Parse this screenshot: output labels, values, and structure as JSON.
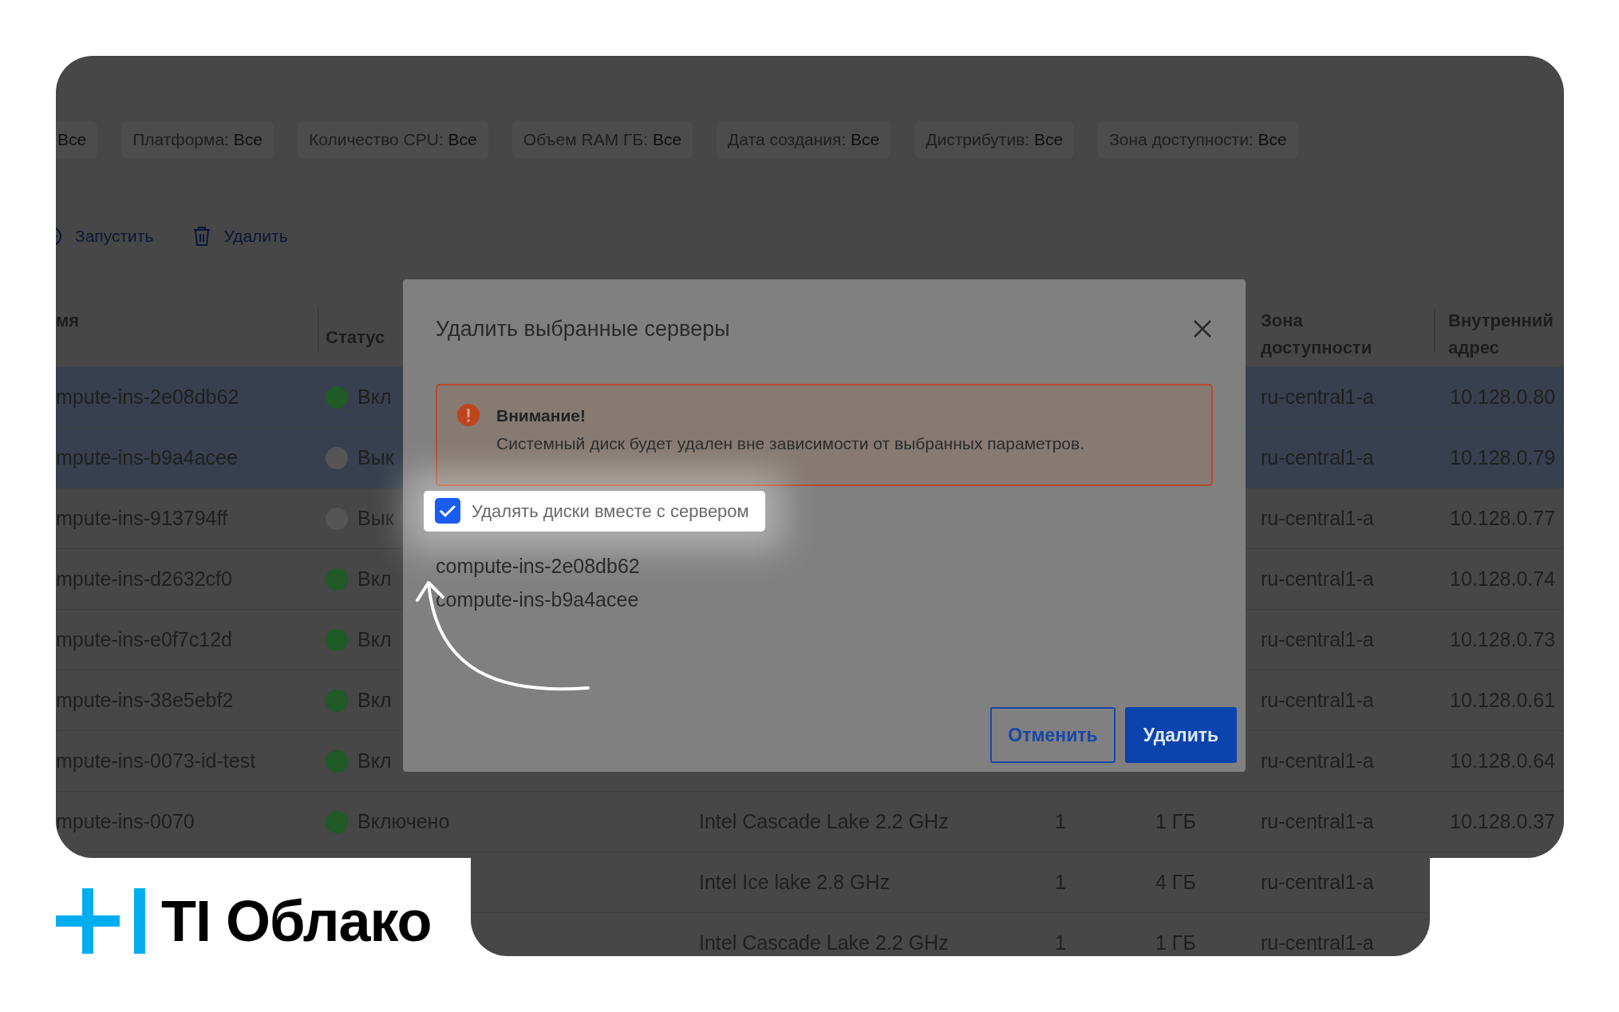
{
  "filters": [
    {
      "value": "Все"
    },
    {
      "label": "Платформа:",
      "value": "Все"
    },
    {
      "label": "Количество CPU:",
      "value": "Все"
    },
    {
      "label": "Объем RAM ГБ:",
      "value": "Все"
    },
    {
      "label": "Дата создания:",
      "value": "Все"
    },
    {
      "label": "Дистрибутив:",
      "value": "Все"
    },
    {
      "label": "Зона доступности:",
      "value": "Все"
    }
  ],
  "actions": [
    {
      "kind": "play",
      "label": "Запустить"
    },
    {
      "kind": "trash",
      "label": "Удалить"
    }
  ],
  "table": {
    "header": {
      "name": "мя",
      "status": "Статус",
      "zone": "Зона доступности",
      "address": "Внутренний адрес"
    },
    "rows": [
      {
        "selected": true,
        "name": "mpute-ins-2e08db62",
        "on": true,
        "status": "Вкл",
        "zone": "ru-central1-a",
        "address": "10.128.0.80"
      },
      {
        "selected": true,
        "name": "mpute-ins-b9a4acee",
        "on": false,
        "status": "Вык",
        "zone": "ru-central1-a",
        "address": "10.128.0.79"
      },
      {
        "selected": false,
        "name": "mpute-ins-913794ff",
        "on": false,
        "status": "Вык",
        "zone": "ru-central1-a",
        "address": "10.128.0.77"
      },
      {
        "selected": false,
        "name": "mpute-ins-d2632cf0",
        "on": true,
        "status": "Вкл",
        "zone": "ru-central1-a",
        "address": "10.128.0.74"
      },
      {
        "selected": false,
        "name": "mpute-ins-e0f7c12d",
        "on": true,
        "status": "Вкл",
        "zone": "ru-central1-a",
        "address": "10.128.0.73"
      },
      {
        "selected": false,
        "name": "mpute-ins-38e5ebf2",
        "on": true,
        "status": "Вкл",
        "zone": "ru-central1-a",
        "address": "10.128.0.61"
      },
      {
        "selected": false,
        "name": "mpute-ins-0073-id-test",
        "on": true,
        "status": "Вкл",
        "zone": "ru-central1-a",
        "address": "10.128.0.64"
      },
      {
        "selected": false,
        "name": "mpute-ins-0070",
        "on": true,
        "status": "Включено",
        "platform": "Intel Cascade Lake 2.2 GHz",
        "cpu": "1",
        "ram": "1 ГБ",
        "zone": "ru-central1-a",
        "address": "10.128.0.37"
      },
      {
        "selected": false,
        "platform": "Intel Ice lake 2.8 GHz",
        "cpu": "1",
        "ram": "4 ГБ",
        "zone": "ru-central1-a"
      },
      {
        "selected": false,
        "platform": "Intel Cascade Lake 2.2 GHz",
        "cpu": "1",
        "ram": "1 ГБ",
        "zone": "ru-central1-a"
      }
    ]
  },
  "modal": {
    "title": "Удалить выбранные серверы",
    "alert": {
      "title": "Внимание!",
      "text": "Системный диск будет удален вне зависимости от выбранных параметров."
    },
    "checkbox": {
      "label": "Удалять диски вместе с сервером",
      "checked": true
    },
    "servers": [
      "compute-ins-2e08db62",
      "compute-ins-b9a4acee"
    ],
    "buttons": [
      {
        "kind": "secondary",
        "label": "Отменить"
      },
      {
        "kind": "primary",
        "label": "Удалить"
      }
    ]
  },
  "logo": {
    "text": "TI Облако"
  }
}
